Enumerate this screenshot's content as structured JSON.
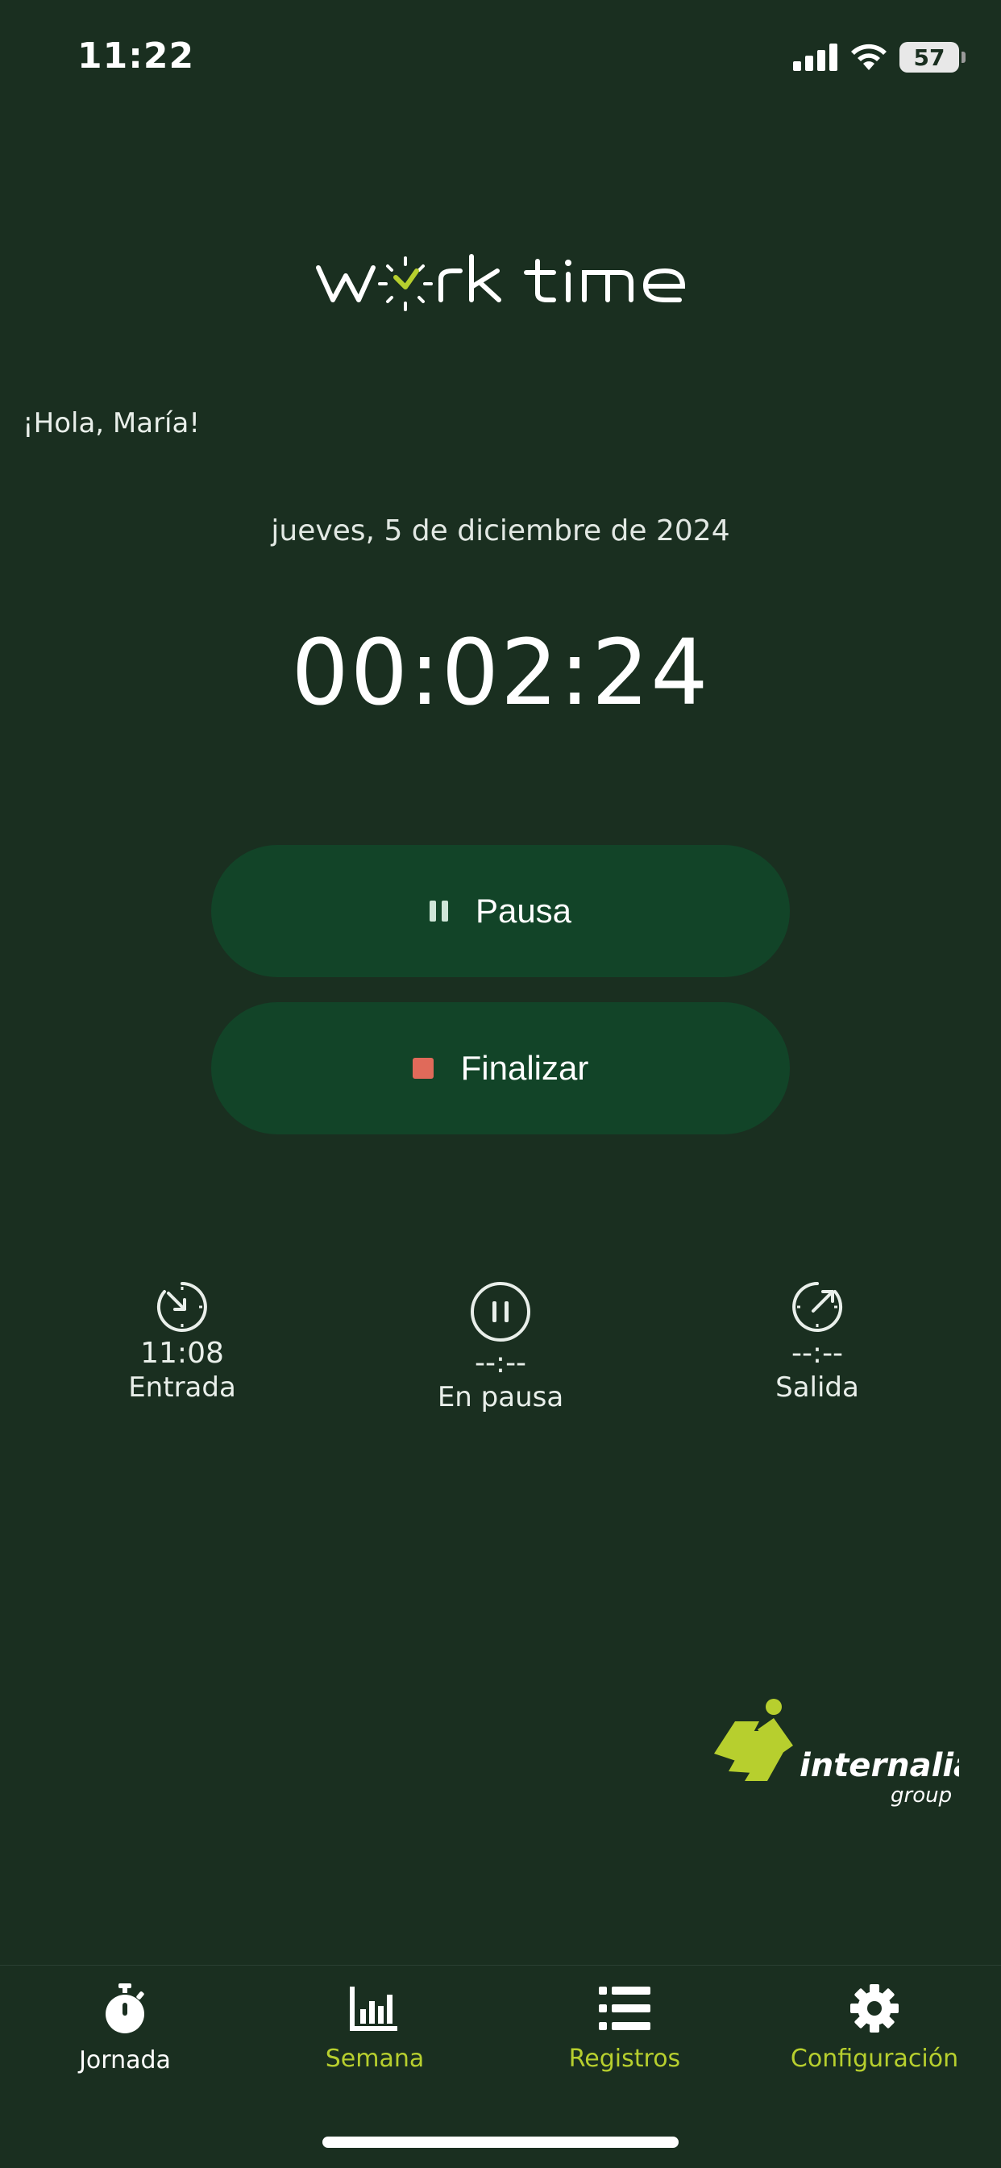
{
  "status": {
    "time": "11:22",
    "battery": "57"
  },
  "app": {
    "logo_text": "work time"
  },
  "greeting": "¡Hola, María!",
  "date": "jueves, 5 de diciembre de 2024",
  "timer": "00:02:24",
  "buttons": {
    "pause": "Pausa",
    "finish": "Finalizar"
  },
  "stats": [
    {
      "value": "11:08",
      "label": "Entrada",
      "icon": "clock-in-icon"
    },
    {
      "value": "--:--",
      "label": "En pausa",
      "icon": "pause-circle-icon"
    },
    {
      "value": "--:--",
      "label": "Salida",
      "icon": "clock-out-icon"
    }
  ],
  "brand": {
    "name": "internalia",
    "sub": "group"
  },
  "tabs": [
    {
      "label": "Jornada",
      "icon": "stopwatch-icon",
      "active": true
    },
    {
      "label": "Semana",
      "icon": "bar-chart-icon",
      "active": false
    },
    {
      "label": "Registros",
      "icon": "list-icon",
      "active": false
    },
    {
      "label": "Configuración",
      "icon": "gear-icon",
      "active": false
    }
  ],
  "colors": {
    "background": "#1a2f20",
    "button": "#124428",
    "accent": "#b7cf2e",
    "stop": "#e06a5a"
  }
}
